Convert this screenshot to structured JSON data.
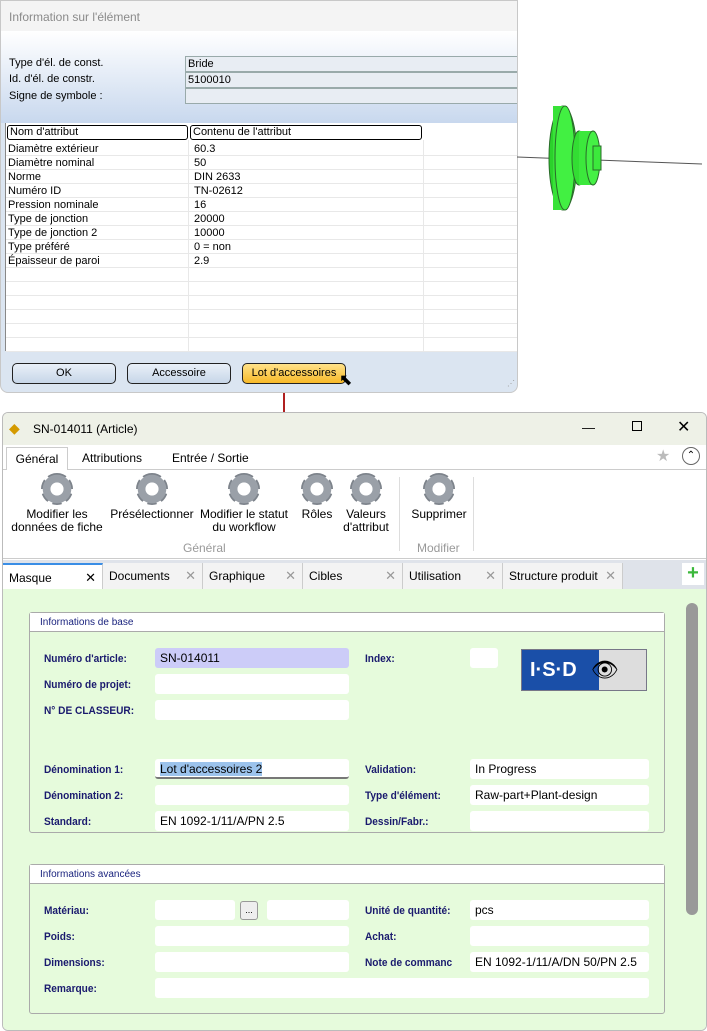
{
  "dialog": {
    "title": "Information sur l'élément",
    "fields": [
      {
        "label": "Type d'él. de const.",
        "value": "Bride"
      },
      {
        "label": "Id. d'él. de constr.",
        "value": "5100010"
      },
      {
        "label": "Signe de symbole :",
        "value": ""
      }
    ],
    "table": {
      "headers": [
        "Nom d'attribut",
        "Contenu de l'attribut"
      ],
      "rows": [
        [
          "Diamètre extérieur",
          "60.3"
        ],
        [
          "Diamètre nominal",
          "50"
        ],
        [
          "Norme",
          "DIN 2633"
        ],
        [
          "Numéro ID",
          "TN-02612"
        ],
        [
          "Pression nominale",
          "16"
        ],
        [
          "Type de jonction",
          "20000"
        ],
        [
          "Type de jonction 2",
          "10000"
        ],
        [
          "Type préféré",
          "0 = non"
        ],
        [
          "Épaisseur de paroi",
          "2.9"
        ]
      ]
    },
    "buttons": {
      "ok": "OK",
      "accessory": "Accessoire",
      "accessory_set": "Lot d'accessoires"
    }
  },
  "window": {
    "title": "SN-014011 (Article)",
    "ribbon_tabs": [
      "Général",
      "Attributions",
      "Entrée / Sortie"
    ],
    "ribbon_buttons": [
      "Modifier les\ndonnées de fiche",
      "Présélectionner",
      "Modifier le statut\ndu workflow",
      "Rôles",
      "Valeurs\nd'attribut",
      "Supprimer"
    ],
    "ribbon_groups": [
      "Général",
      "Modifier"
    ],
    "doc_tabs": [
      "Masque",
      "Documents",
      "Graphique",
      "Cibles",
      "Utilisation",
      "Structure produit"
    ],
    "basic": {
      "title": "Informations de base",
      "article_no_label": "Numéro d'article:",
      "article_no": "SN-014011",
      "project_label": "Numéro de projet:",
      "folder_label": "N° DE CLASSEUR:",
      "index_label": "Index:",
      "logo": "I·S·D",
      "name1_label": "Dénomination 1:",
      "name1": "Lot d'accessoires 2",
      "name2_label": "Dénomination 2:",
      "standard_label": "Standard:",
      "standard": "EN 1092-1/11/A/PN 2.5",
      "validation_label": "Validation:",
      "validation": "In Progress",
      "type_label": "Type d'élément:",
      "type": "Raw-part+Plant-design",
      "drawing_label": "Dessin/Fabr.:"
    },
    "advanced": {
      "title": "Informations avancées",
      "material_label": "Matériau:",
      "browse": "...",
      "weight_label": "Poids:",
      "dimensions_label": "Dimensions:",
      "remark_label": "Remarque:",
      "unit_label": "Unité de quantité:",
      "unit": "pcs",
      "purchase_label": "Achat:",
      "order_note_label": "Note de commanc",
      "order_note": "EN 1092-1/11/A/DN 50/PN 2.5"
    }
  }
}
